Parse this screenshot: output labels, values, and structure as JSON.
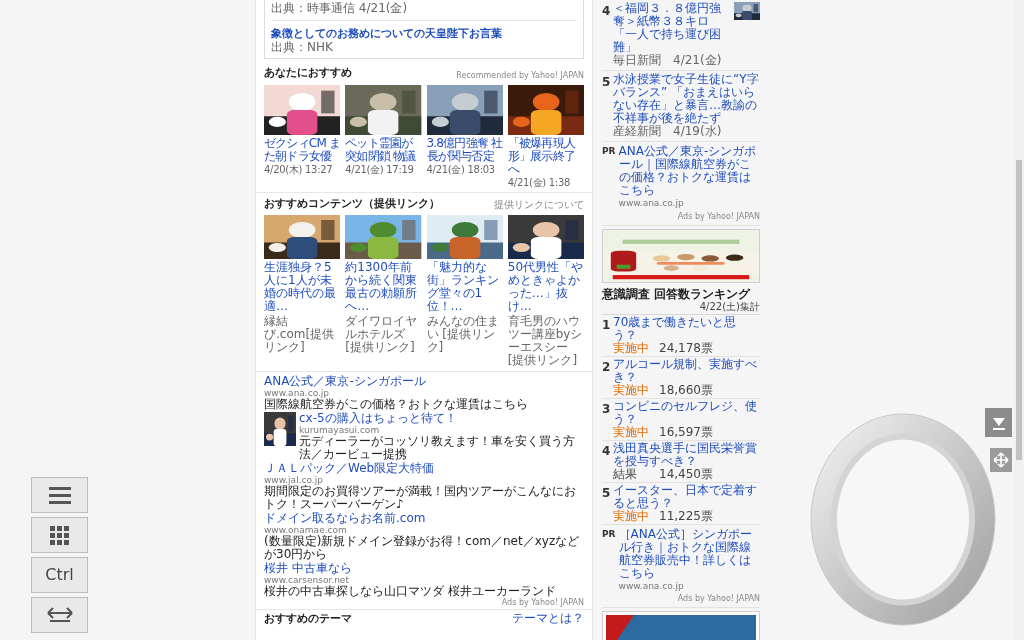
{
  "top_card": {
    "items": [
      {
        "source": "出典：時事通信 4/21(金)"
      },
      {
        "title": "象徴としてのお務めについての天皇陛下お言葉",
        "source": "出典：NHK"
      }
    ]
  },
  "recommended": {
    "heading": "あなたにおすすめ",
    "credit": "Recommended by Yahoo! JAPAN",
    "items": [
      {
        "title": "ゼクシィCM また朝ドラ女優",
        "time": "4/20(木) 13:27"
      },
      {
        "title": "ペット霊園が突如閉鎖 物議",
        "time": "4/21(金) 17:19"
      },
      {
        "title": "3.8億円強奪 社長が関与否定",
        "time": "4/21(金) 18:03"
      },
      {
        "title": "「被爆再現人形」展示終了へ",
        "time": "4/21(金) 1:38"
      }
    ]
  },
  "sponsored": {
    "heading": "おすすめコンテンツ（提供リンク）",
    "about_link": "提供リンクについて",
    "items": [
      {
        "title": "生涯独身？5人に1人が未婚の時代の最適…",
        "source": "縁結び.com[提供リンク]"
      },
      {
        "title": "約1300年前から続く関東最古の勅願所へ…",
        "source": "ダイワロイヤルホテルズ[提供リンク]"
      },
      {
        "title": "「魅力的な街」ランキング堂々の1位！…",
        "source": "みんなの住まい [提供リンク]"
      },
      {
        "title": "50代男性「やめときゃよかった…」抜け…",
        "source": "育毛男のハウツー講座byシーエスシー[提供リンク]"
      }
    ]
  },
  "text_ads": {
    "items": [
      {
        "title": "ANA公式／東京-シンガポール",
        "url": "www.ana.co.jp",
        "description": "国際線航空券がこの価格？おトクな運賃はこちら",
        "thumbnail": false
      },
      {
        "title": "cx-5の購入はちょっと待て！",
        "url": "kurumayasui.com",
        "description": "元ディーラーがコッソリ教えます！車を安く買う方法／カービュー提携",
        "thumbnail": true
      },
      {
        "title": "ＪＡＬパック／Web限定大特価",
        "url": "www.jal.co.jp",
        "description": "期間限定のお買得ツアーが満載！国内ツアーがこんなにおトク！スーパーバーゲン♪",
        "thumbnail": false
      },
      {
        "title": "ドメイン取るならお名前.com",
        "url": "www.onamae.com",
        "description": "(数量限定)新規ドメイン登録がお得！com／net／xyzなどが30円から",
        "thumbnail": false
      },
      {
        "title": "桜井 中古車なら",
        "url": "www.carsensor.net",
        "description": "桜井の中古車探しなら山口マツダ 桜井ユーカーランド",
        "thumbnail": false
      }
    ],
    "credit": "Ads by Yahoo! JAPAN"
  },
  "themes": {
    "heading": "おすすめのテーマ",
    "link": "テーマとは？"
  },
  "ranking_news": {
    "items": [
      {
        "rank": "4",
        "title": "＜福岡３．８億円強奪＞紙幣３８キロ「一人で持ち運び困難」",
        "source": "毎日新聞　4/21(金)",
        "thumbnail": true
      },
      {
        "rank": "5",
        "title": "水泳授業で女子生徒に“Y字バランス” 「おまえはいらない存在」と暴言…教諭の不祥事が後を絶たず",
        "source": "産経新聞　4/19(水)",
        "thumbnail": false
      }
    ]
  },
  "side_pr_1": {
    "mark": "PR",
    "title": "ANA公式／東京-シンガポール｜国際線航空券がこの価格？おトクな運賃はこちら",
    "url": "www.ana.co.jp",
    "credit": "Ads by Yahoo! JAPAN"
  },
  "poll_ranking": {
    "heading": "意識調査 回答数ランキング",
    "date": "4/22(土)集計",
    "items": [
      {
        "rank": "1",
        "title": "70歳まで働きたいと思う？",
        "status": "実施中",
        "open": true,
        "votes": "24,178票"
      },
      {
        "rank": "2",
        "title": "アルコール規制、実施すべき？",
        "status": "実施中",
        "open": true,
        "votes": "18,660票"
      },
      {
        "rank": "3",
        "title": "コンビニのセルフレジ、使う？",
        "status": "実施中",
        "open": true,
        "votes": "16,597票"
      },
      {
        "rank": "4",
        "title": "浅田真央選手に国民栄誉賞を授与すべき？",
        "status": "結果",
        "open": false,
        "votes": "14,450票"
      },
      {
        "rank": "5",
        "title": "イースター、日本で定着すると思う？",
        "status": "実施中",
        "open": true,
        "votes": "11,225票"
      }
    ]
  },
  "side_pr_2": {
    "mark": "PR",
    "title": "［ANA公式］シンガポール行き｜おトクな国際線航空券販売中！詳しくはこちら",
    "url": "www.ana.co.jp",
    "credit": "Ads by Yahoo! JAPAN"
  },
  "overlay": {
    "ctrl_key": "Ctrl"
  }
}
